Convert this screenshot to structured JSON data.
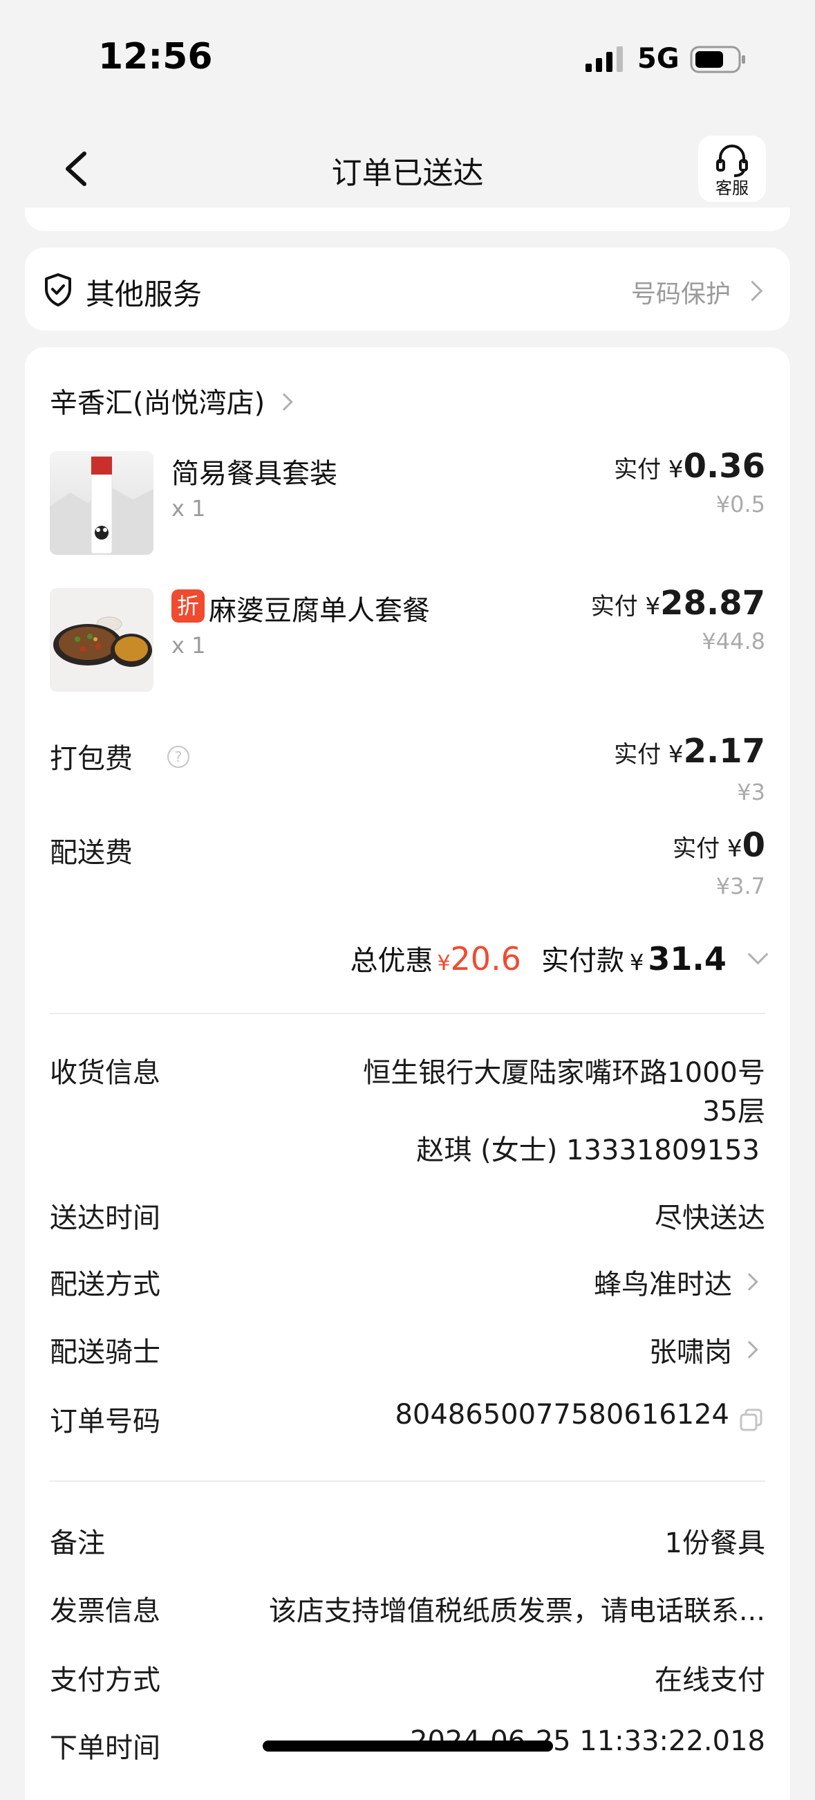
{
  "status_bar": {
    "time": "12:56",
    "network": "5G"
  },
  "header": {
    "title": "订单已送达",
    "service_label": "客服"
  },
  "services": {
    "label": "其他服务",
    "right_label": "号码保护"
  },
  "store": {
    "name": "辛香汇(尚悦湾店)"
  },
  "items": [
    {
      "name": "简易餐具套装",
      "qty": "x 1",
      "paid_prefix": "实付 ¥",
      "paid": "0.36",
      "original": "¥0.5",
      "discount_badge": ""
    },
    {
      "name": "麻婆豆腐单人套餐",
      "qty": "x 1",
      "paid_prefix": "实付 ¥",
      "paid": "28.87",
      "original": "¥44.8",
      "discount_badge": "折"
    }
  ],
  "fees": {
    "packing": {
      "label": "打包费",
      "paid_prefix": "实付 ¥",
      "paid": "2.17",
      "original": "¥3"
    },
    "delivery": {
      "label": "配送费",
      "paid_prefix": "实付 ¥",
      "paid": "0",
      "original": "¥3.7"
    }
  },
  "totals": {
    "discount_label": "总优惠",
    "discount_currency": "¥",
    "discount_value": "20.6",
    "paid_label": "实付款",
    "paid_currency": "¥",
    "paid_value": "31.4"
  },
  "delivery_info": {
    "receiver_label": "收货信息",
    "address_line1": "恒生银行大厦陆家嘴环路1000号",
    "address_line2": "35层",
    "contact": "赵琪 (女士) 13331809153",
    "time_label": "送达时间",
    "time_value": "尽快送达",
    "method_label": "配送方式",
    "method_value": "蜂鸟准时达",
    "rider_label": "配送骑士",
    "rider_value": "张啸岗",
    "order_label": "订单号码",
    "order_value": "8048650077580616124"
  },
  "misc": {
    "note_label": "备注",
    "note_value": "1份餐具",
    "invoice_label": "发票信息",
    "invoice_value": "该店支持增值税纸质发票，请电话联系...",
    "payment_label": "支付方式",
    "payment_value": "在线支付",
    "order_time_label": "下单时间",
    "order_time_value": "2024-06-25 11:33:22.018"
  },
  "colors": {
    "accent_red": "#f04a2f",
    "background": "#f3f3f3"
  }
}
